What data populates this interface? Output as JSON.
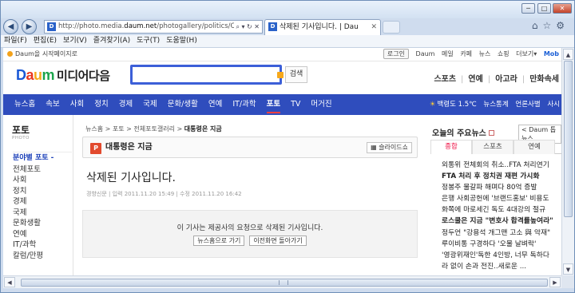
{
  "window": {
    "minimize": "─",
    "maximize": "□",
    "close": "✕"
  },
  "nav": {
    "back": "◀",
    "forward": "▶",
    "url_prefix": "http://photo.media.",
    "url_domain": "daum.net",
    "url_rest": "/photogallery/politics/C",
    "address_buttons": "⌕ ▾ ↻ ✕",
    "favicon": "D",
    "tab_title": "삭제된 기사입니다. | Dau",
    "tab_close": "✕",
    "tools": "⌂☆⚙"
  },
  "menu": [
    "파일(F)",
    "편집(E)",
    "보기(V)",
    "즐겨찾기(A)",
    "도구(T)",
    "도움말(H)"
  ],
  "topbar": {
    "home_link": "Daum을 시작페이지로",
    "login": "로그인",
    "links": [
      "Daum",
      "메일",
      "카페",
      "뉴스",
      "쇼핑",
      "더보기▾"
    ],
    "mobile": "Mob"
  },
  "logo": {
    "d": "D",
    "a": "a",
    "u": "u",
    "m": "m",
    "sub": "미디어다음"
  },
  "search": {
    "button": "검색",
    "value": ""
  },
  "services": [
    "스포츠",
    "연예",
    "아고라",
    "만화속세"
  ],
  "gnb": {
    "items": [
      "뉴스홈",
      "속보",
      "사회",
      "정치",
      "경제",
      "국제",
      "문화/생활",
      "연예",
      "IT/과학",
      "포토",
      "TV",
      "머거진"
    ],
    "active": "포토",
    "weather": "백령도 1.5℃",
    "right_links": [
      "뉴스통계",
      "언론사별",
      "사시"
    ]
  },
  "lnb": {
    "title": "포토",
    "subtitle": "PHOTO",
    "section_header": "분야별 포토 -",
    "items": [
      "전체포토",
      "사회",
      "정치",
      "경제",
      "국제",
      "문화생활",
      "연예",
      "IT/과학",
      "칼럼/만평"
    ]
  },
  "breadcrumb": [
    "뉴스홈",
    "포토",
    "전체포토갤러리",
    "대통령은 지금"
  ],
  "section": {
    "icon": "P",
    "title": "대통령은 지금",
    "slideshow": "슬라이드쇼"
  },
  "article": {
    "title": "삭제된 기사입니다.",
    "source": "경향신문",
    "input_label": "입력",
    "input_time": "2011.11.20 15:49",
    "edit_label": "수정",
    "edit_time": "2011.11.20 16:42"
  },
  "notice": {
    "message": "이 기사는 제공사의 요청으로 삭제된 기사입니다.",
    "btn_news_home": "뉴스홈으로 가기",
    "btn_prev": "이전화면 돌아가기"
  },
  "news": {
    "title": "오늘의 주요뉴스",
    "daum_tv": "< Daum 톱뉴스",
    "tabs": [
      "종합",
      "스포츠",
      "연예"
    ],
    "active_tab": "종합",
    "items": [
      {
        "text": "외통위 전체회의 취소..FTA 처리연기",
        "bold": false
      },
      {
        "text": "FTA 처리 후 정치권 재편 가시화",
        "bold": true
      },
      {
        "text": "정봉주 물갈파 해며다 80억 증발",
        "bold": false
      },
      {
        "text": "은행 사회공헌에 '브랜드홍보' 비용도",
        "bold": false
      },
      {
        "text": "화쪽에 마로세긴 독도 4대강의 절규",
        "bold": false
      },
      {
        "text": "로스쿨은 지금 \"변호사 합격률높여라\"",
        "bold": true
      },
      {
        "text": "정두언 \"강용석 개그맨 고소 與 악재\"",
        "bold": false
      },
      {
        "text": "루이비통 구경하다 '오물 날벼락'",
        "bold": false
      },
      {
        "text": "'영광위재인'독한 4인방, 너무 독하다",
        "bold": false
      },
      {
        "text": "라 없이 손과 전진..새로운 ...",
        "bold": false
      }
    ]
  },
  "scroll": {
    "up": "▲",
    "down": "▼",
    "left": "◀",
    "right": "▶"
  }
}
